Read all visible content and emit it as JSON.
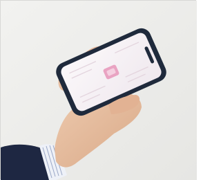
{
  "scene": {
    "subject": "hand-holding-smartphone",
    "background_color": "#eeeeec",
    "phone_case_color": "#1f2a3c",
    "screen_color": "#f7f3f6",
    "accent_color": "#e9a3c2",
    "skin_color": "#e6bfa3",
    "sleeve_color": "#1e2742",
    "cuff_color": "#eef1f8"
  }
}
